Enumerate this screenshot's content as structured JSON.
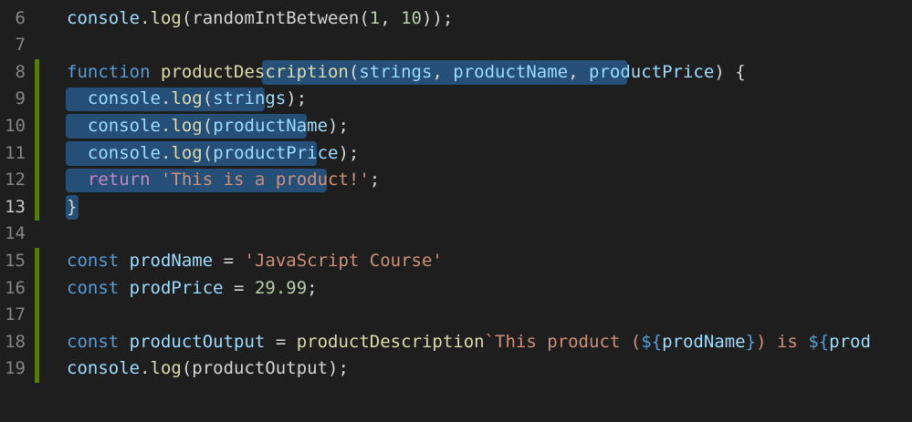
{
  "editor": {
    "first_line_number": 6,
    "active_line_number": 13,
    "lines": [
      [
        [
          "console",
          "vr"
        ],
        [
          ".",
          "pn"
        ],
        [
          "log",
          "fn"
        ],
        [
          "(randomIntBetween(",
          "pn"
        ],
        [
          "1",
          "num"
        ],
        [
          ", ",
          "pn"
        ],
        [
          "10",
          "num"
        ],
        [
          "));",
          "pn"
        ]
      ],
      [],
      [
        [
          "function",
          "kw"
        ],
        [
          " ",
          "pn"
        ],
        [
          "productDescription",
          "fn"
        ],
        [
          "(",
          "pn"
        ],
        [
          "strings",
          "vr"
        ],
        [
          ", ",
          "pn"
        ],
        [
          "productName",
          "vr"
        ],
        [
          ", ",
          "pn"
        ],
        [
          "productPrice",
          "vr"
        ],
        [
          ") {",
          "pn"
        ]
      ],
      [
        [
          "  ",
          "pn"
        ],
        [
          "console",
          "vr"
        ],
        [
          ".",
          "pn"
        ],
        [
          "log",
          "fn"
        ],
        [
          "(",
          "pn"
        ],
        [
          "strings",
          "vr"
        ],
        [
          ");",
          "pn"
        ]
      ],
      [
        [
          "  ",
          "pn"
        ],
        [
          "console",
          "vr"
        ],
        [
          ".",
          "pn"
        ],
        [
          "log",
          "fn"
        ],
        [
          "(",
          "pn"
        ],
        [
          "productName",
          "vr"
        ],
        [
          ");",
          "pn"
        ]
      ],
      [
        [
          "  ",
          "pn"
        ],
        [
          "console",
          "vr"
        ],
        [
          ".",
          "pn"
        ],
        [
          "log",
          "fn"
        ],
        [
          "(",
          "pn"
        ],
        [
          "productPrice",
          "vr"
        ],
        [
          ");",
          "pn"
        ]
      ],
      [
        [
          "  ",
          "pn"
        ],
        [
          "return",
          "kw2"
        ],
        [
          " ",
          "pn"
        ],
        [
          "'This is a product!'",
          "str"
        ],
        [
          ";",
          "pn"
        ]
      ],
      [
        [
          "}",
          "pn"
        ]
      ],
      [],
      [
        [
          "const",
          "kw"
        ],
        [
          " ",
          "pn"
        ],
        [
          "prodName",
          "vr"
        ],
        [
          " = ",
          "pn"
        ],
        [
          "'JavaScript Course'",
          "str"
        ]
      ],
      [
        [
          "const",
          "kw"
        ],
        [
          " ",
          "pn"
        ],
        [
          "prodPrice",
          "vr"
        ],
        [
          " = ",
          "pn"
        ],
        [
          "29.99",
          "num"
        ],
        [
          ";",
          "pn"
        ]
      ],
      [],
      [
        [
          "const",
          "kw"
        ],
        [
          " ",
          "pn"
        ],
        [
          "productOutput",
          "vr"
        ],
        [
          " = ",
          "pn"
        ],
        [
          "productDescription",
          "fn"
        ],
        [
          "`This product (",
          "str"
        ],
        [
          "${",
          "kw"
        ],
        [
          "prodName",
          "vr"
        ],
        [
          "}",
          "kw"
        ],
        [
          ") is ",
          "str"
        ],
        [
          "${",
          "kw"
        ],
        [
          "prod",
          "vr"
        ]
      ],
      [
        [
          "console",
          "vr"
        ],
        [
          ".",
          "pn"
        ],
        [
          "log",
          "fn"
        ],
        [
          "(productOutput);",
          "pn"
        ]
      ]
    ],
    "git_bars": [
      {
        "from_line": 8,
        "to_line": 13,
        "color": "#587c0c"
      },
      {
        "from_line": 15,
        "to_line": 19,
        "color": "#587c0c"
      }
    ],
    "selection": [
      {
        "line": 8,
        "from_col": 19,
        "to_col": 54
      },
      {
        "line": 9,
        "from_col": 0,
        "to_col": 19
      },
      {
        "line": 10,
        "from_col": 0,
        "to_col": 23
      },
      {
        "line": 11,
        "from_col": 0,
        "to_col": 24
      },
      {
        "line": 12,
        "from_col": 0,
        "to_col": 25
      },
      {
        "line": 13,
        "from_col": 0,
        "to_col": 1
      }
    ]
  }
}
